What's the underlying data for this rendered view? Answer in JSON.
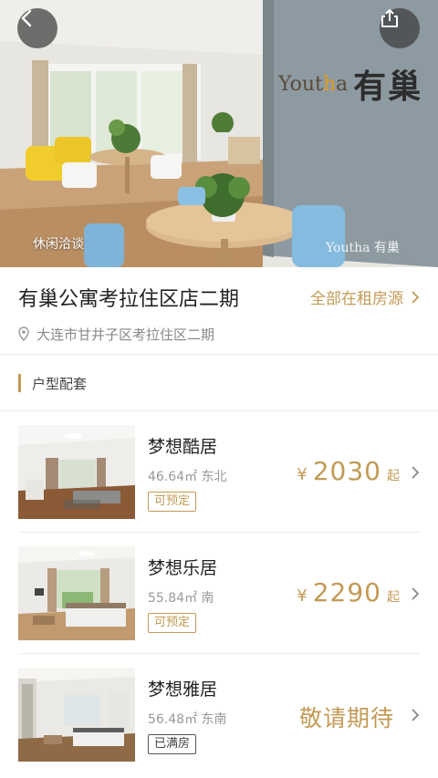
{
  "hero": {
    "caption": "休闲洽谈",
    "watermark": "Youtha 有巢",
    "wall_brand_en_prefix": "Yout",
    "wall_brand_en_accent": "h",
    "wall_brand_en_suffix": "a",
    "wall_brand_cn": "有巢",
    "back_icon": "chevron-left-icon",
    "share_icon": "share-icon"
  },
  "header": {
    "title": "有巢公寓考拉住区店二期",
    "all_listings": "全部在租房源",
    "address": "大连市甘井子区考拉住区二期"
  },
  "section": {
    "title": "户型配套"
  },
  "rooms": [
    {
      "name": "梦想酷居",
      "area": "46.64㎡",
      "orientation": "东北",
      "currency": "¥",
      "price": "2030",
      "price_suffix": "起",
      "status": "可预定"
    },
    {
      "name": "梦想乐居",
      "area": "55.84㎡",
      "orientation": "南",
      "currency": "¥",
      "price": "2290",
      "price_suffix": "起",
      "status": "可预定"
    },
    {
      "name": "梦想雅居",
      "area": "56.48㎡",
      "orientation": "东南",
      "price_text": "敬请期待",
      "status": "已满房"
    }
  ],
  "colors": {
    "accent": "#c39a55",
    "divider": "#ececec",
    "muted": "#999999"
  }
}
